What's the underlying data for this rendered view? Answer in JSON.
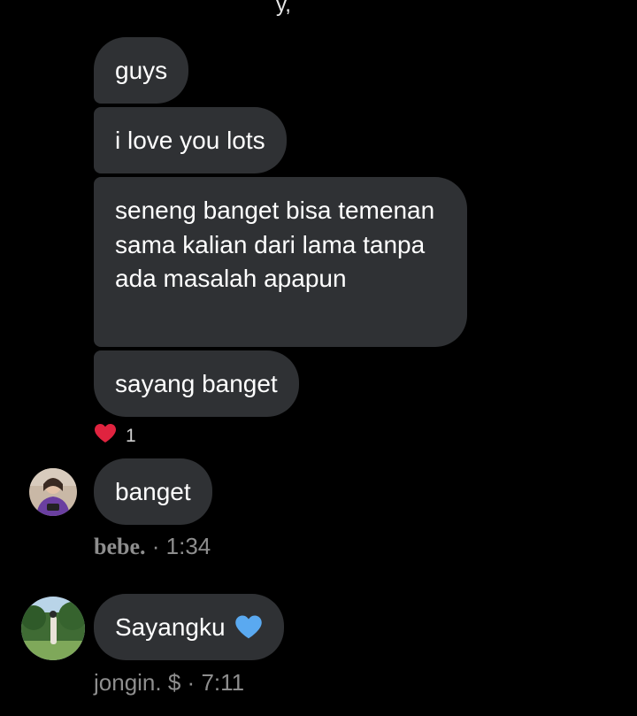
{
  "top_fragment": "y,",
  "messages": [
    {
      "text": "guys"
    },
    {
      "text": "i love you lots"
    },
    {
      "text": "seneng banget bisa temenan sama kalian dari lama tanpa ada masalah apapun"
    },
    {
      "text": "sayang banget"
    }
  ],
  "reaction": {
    "icon": "heart-icon",
    "count": "1",
    "color": "#e0233f"
  },
  "bebe": {
    "message": "banget",
    "name": "bebe.",
    "separator": "·",
    "time": "1:34"
  },
  "jongin": {
    "message": "Sayangku",
    "emoji": "blue-heart-icon",
    "name": "jongin. $",
    "separator": "·",
    "time": "7:11"
  },
  "colors": {
    "background": "#000000",
    "bubble": "#2f3134",
    "meta_text": "#8e8e8e",
    "blue_heart": "#5aa9f0"
  }
}
